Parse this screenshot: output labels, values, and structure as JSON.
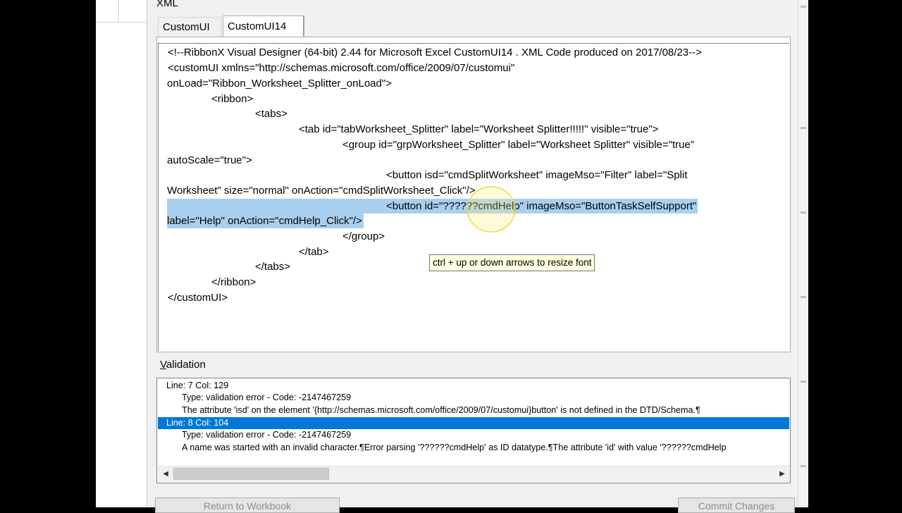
{
  "dialog": {
    "section_label": "XML",
    "tabs": [
      "CustomUI",
      "CustomUI14"
    ],
    "active_tab": "CustomUI14"
  },
  "editor": {
    "lines": [
      "<!--RibbonX Visual Designer (64-bit) 2.44 for Microsoft Excel CustomUI14 . XML Code produced on 2017/08/23-->",
      "<customUI xmlns=\"http://schemas.microsoft.com/office/2009/07/customui\"",
      "onLoad=\"Ribbon_Worksheet_Splitter_onLoad\">",
      "<ribbon>",
      "<tabs>",
      "<tab id=\"tabWorksheet_Splitter\" label=\"Worksheet Splitter!!!!!\" visible=\"true\">",
      "<group id=\"grpWorksheet_Splitter\" label=\"Worksheet Splitter\" visible=\"true\"",
      "autoScale=\"true\">",
      "<button isd=\"cmdSplitWorksheet\" imageMso=\"Filter\" label=\"Split",
      "Worksheet\" size=\"normal\" onAction=\"cmdSplitWorksheet_Click\"/>",
      "<button id=\"??????cmdHelp\" imageMso=\"ButtonTaskSelfSupport\"",
      "label=\"Help\" onAction=\"cmdHelp_Click\"/>",
      "</group>",
      "</tab>",
      "</tabs>",
      "</ribbon>",
      "</customUI>"
    ],
    "tooltip": "ctrl + up or down arrows to resize font"
  },
  "validation": {
    "label_first": "V",
    "label_rest": "alidation",
    "entries": [
      "Line: 7 Col: 129",
      "Type: validation error - Code: -2147467259",
      "The attribute 'isd' on the element '{http://schemas.microsoft.com/office/2009/07/customui}button' is not defined in the DTD/Schema.¶",
      "Line: 8 Col: 104",
      "Type: validation error - Code: -2147467259",
      "A name was started with an invalid character.¶Error parsing '??????cmdHelp' as ID datatype.¶The attribute 'id' with value '??????cmdHelp"
    ]
  },
  "buttons": {
    "left": "Return to Workbook",
    "right": "Commit Changes"
  },
  "colors": {
    "selection": "#a8cff0",
    "validation_selected": "#0078d7",
    "tooltip_bg": "#ffffe1"
  }
}
